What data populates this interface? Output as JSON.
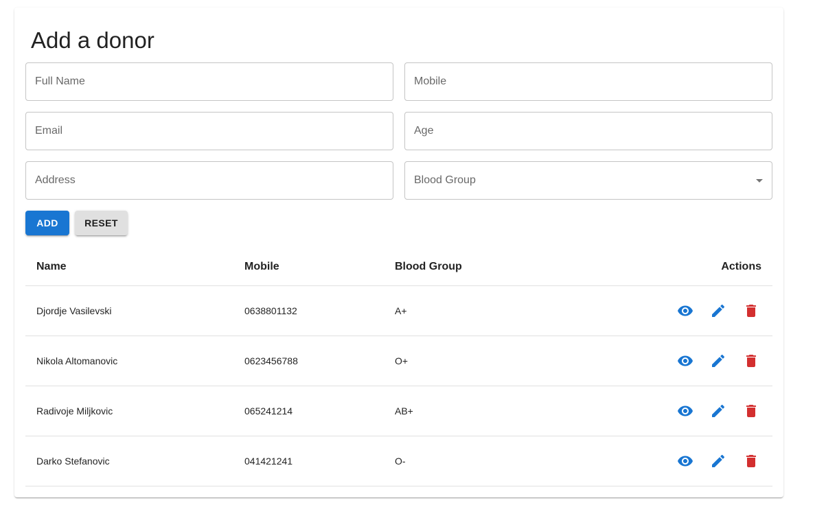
{
  "form": {
    "title": "Add a donor",
    "full_name_placeholder": "Full Name",
    "mobile_placeholder": "Mobile",
    "email_placeholder": "Email",
    "age_placeholder": "Age",
    "address_placeholder": "Address",
    "blood_group_placeholder": "Blood Group",
    "add_label": "ADD",
    "reset_label": "RESET"
  },
  "table": {
    "headers": {
      "name": "Name",
      "mobile": "Mobile",
      "blood_group": "Blood Group",
      "actions": "Actions"
    },
    "rows": [
      {
        "name": "Djordje Vasilevski",
        "mobile": "0638801132",
        "blood_group": "A+"
      },
      {
        "name": "Nikola Altomanovic",
        "mobile": "0623456788",
        "blood_group": "O+"
      },
      {
        "name": "Radivoje Miljkovic",
        "mobile": "065241214",
        "blood_group": "AB+"
      },
      {
        "name": "Darko Stefanovic",
        "mobile": "041421241",
        "blood_group": "O-"
      }
    ],
    "row_actions": [
      "eye-icon",
      "pencil-icon",
      "trash-icon"
    ]
  },
  "colors": {
    "primary": "#1976d2",
    "danger": "#d32f2f",
    "reset_button": "#e0e0e0"
  }
}
